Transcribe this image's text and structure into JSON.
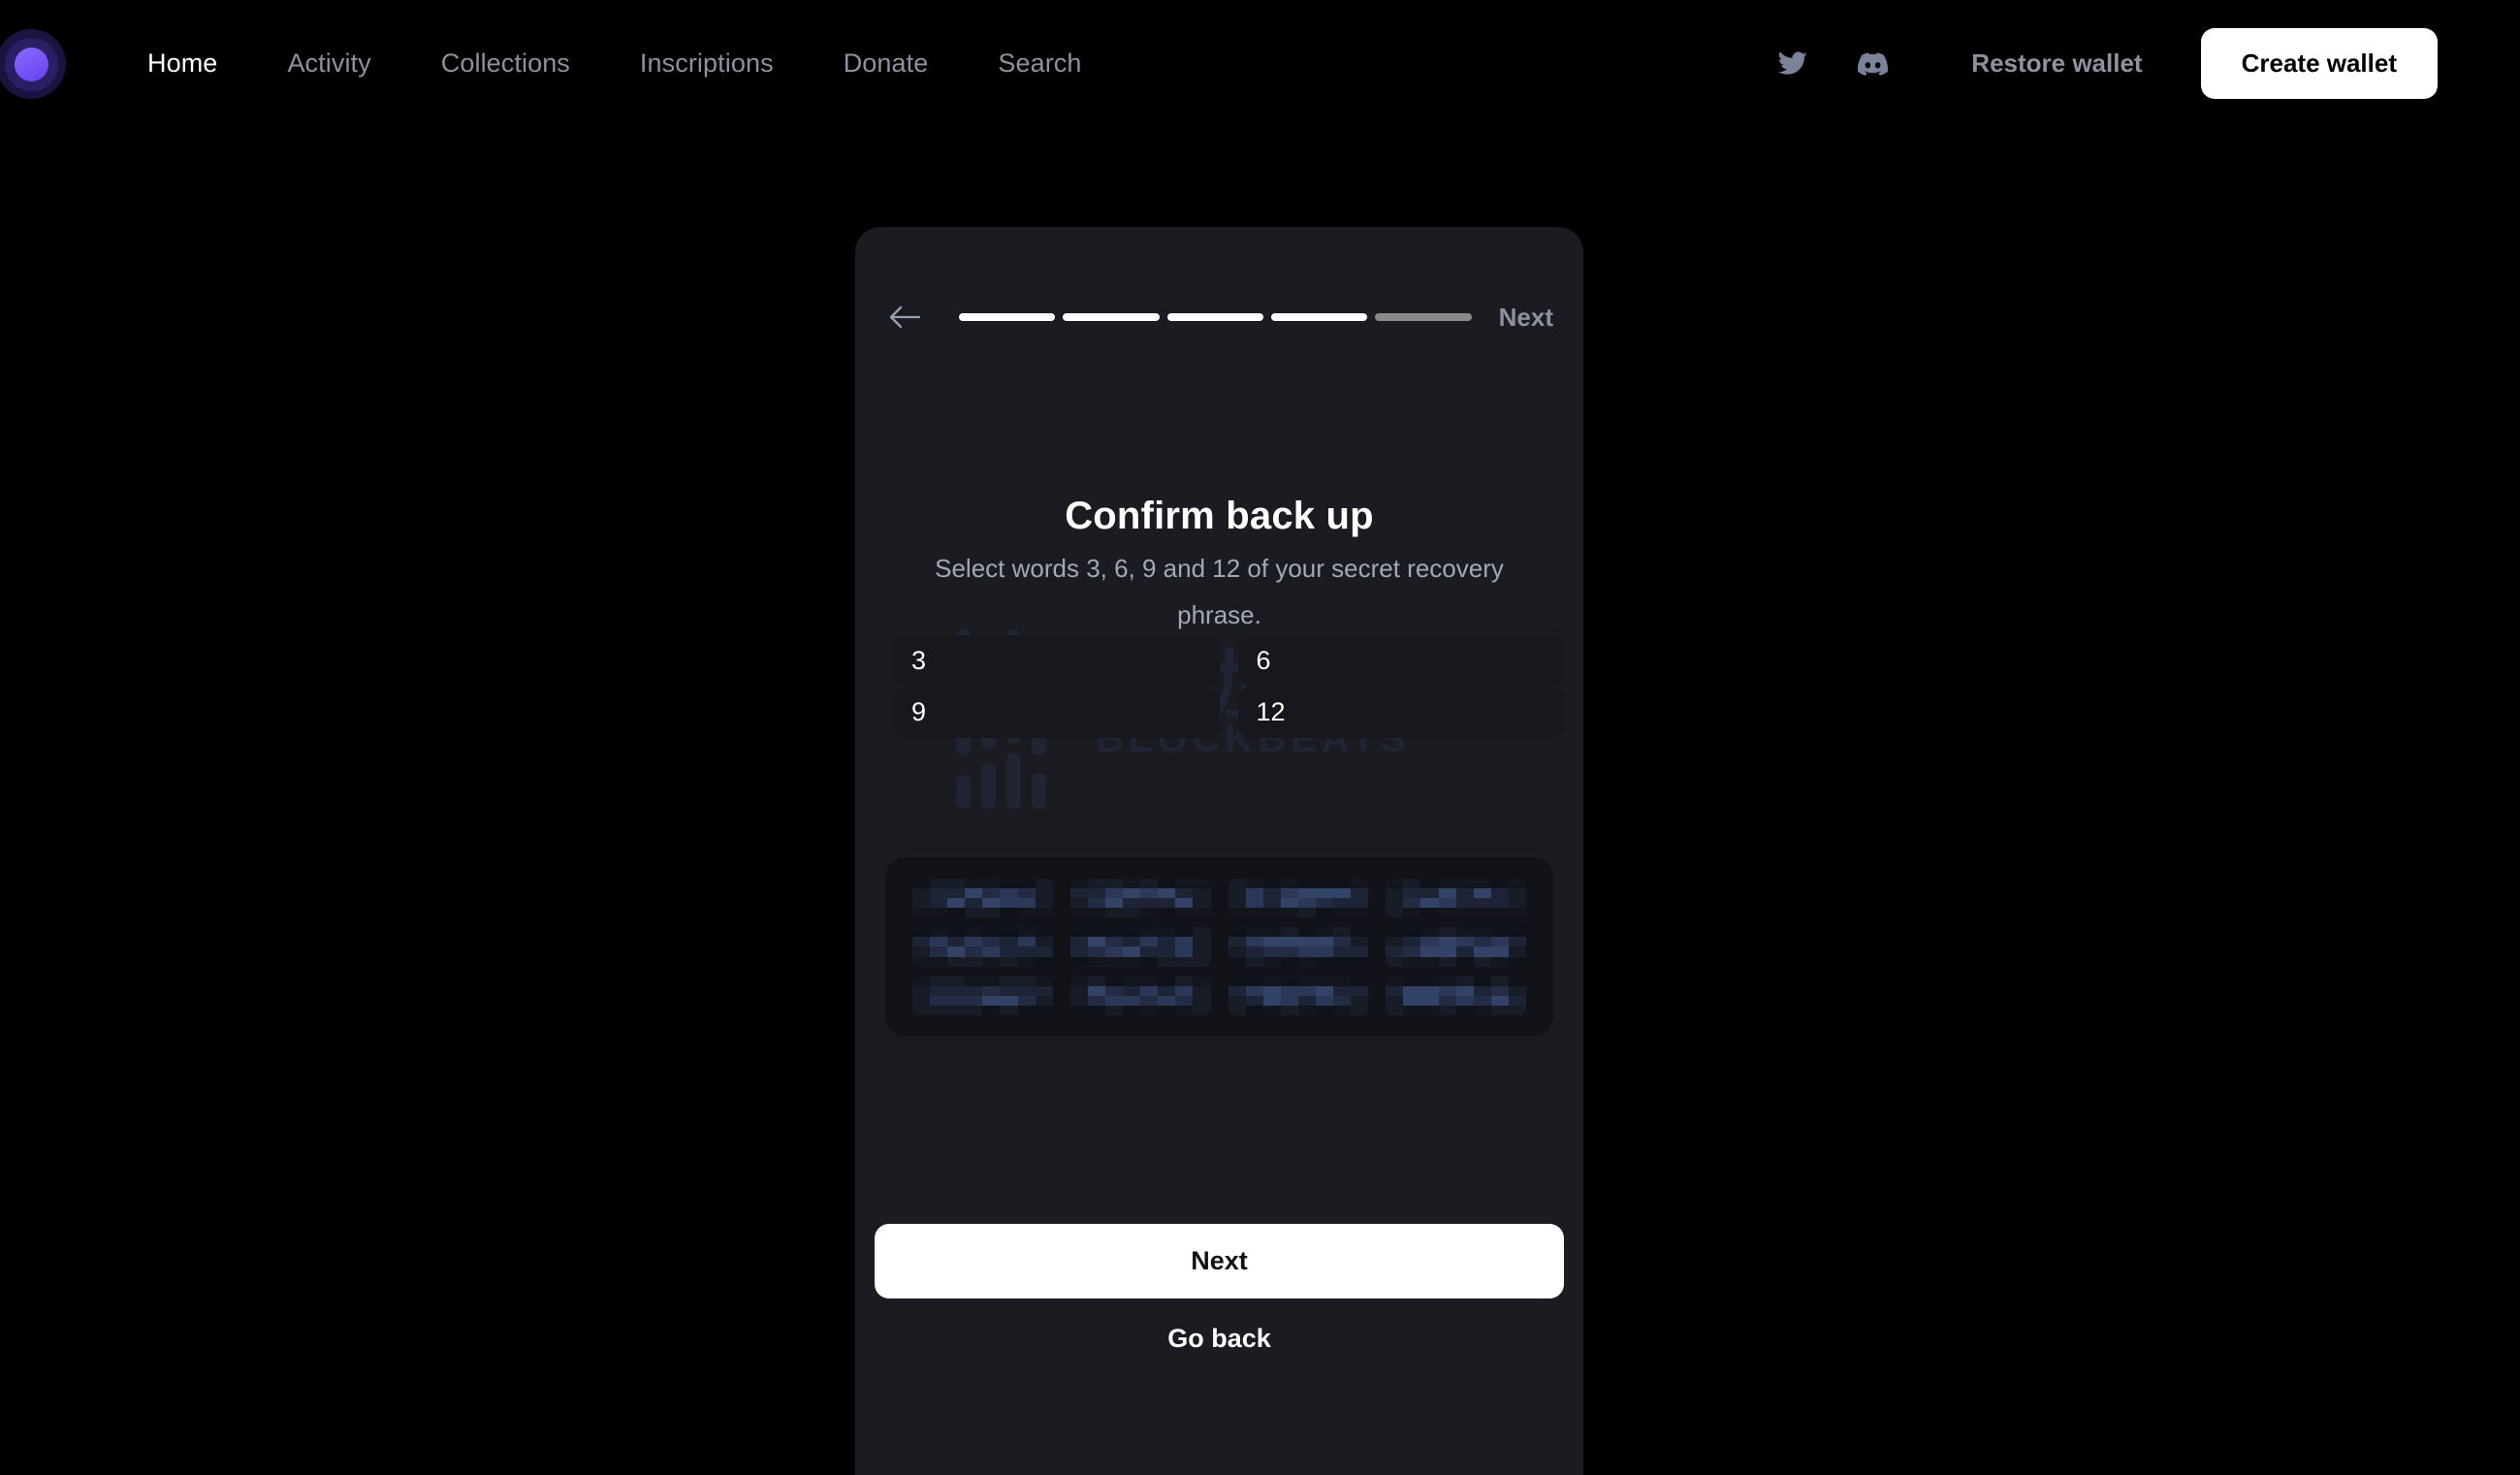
{
  "site": {
    "background_color": "#000000",
    "logo_name": "app-logo",
    "logo_color": "#6341f0"
  },
  "nav": {
    "items": [
      {
        "label": "Home",
        "active": true
      },
      {
        "label": "Activity",
        "active": false
      },
      {
        "label": "Collections",
        "active": false
      },
      {
        "label": "Inscriptions",
        "active": false
      },
      {
        "label": "Donate",
        "active": false
      },
      {
        "label": "Search",
        "active": false
      }
    ],
    "social": [
      {
        "name": "twitter-icon"
      },
      {
        "name": "discord-icon"
      }
    ],
    "restore_label": "Restore wallet",
    "create_label": "Create wallet"
  },
  "modal": {
    "background_color": "#1a1c21",
    "header": {
      "back_icon": "arrow-left-icon",
      "next_label": "Next",
      "progress": {
        "total_steps": 5,
        "completed_steps": 4,
        "done_color": "#ffffff",
        "pending_color": "#8a8a8a"
      }
    },
    "title": "Confirm back up",
    "subtitle": "Select words 3, 6, 9 and 12 of your secret recovery phrase.",
    "slots": [
      {
        "number": "3",
        "value": ""
      },
      {
        "number": "6",
        "value": ""
      },
      {
        "number": "9",
        "value": ""
      },
      {
        "number": "12",
        "value": ""
      }
    ],
    "word_pool": {
      "censored": true,
      "count": 12,
      "chips": [
        {
          "index": 1,
          "label": ""
        },
        {
          "index": 2,
          "label": ""
        },
        {
          "index": 3,
          "label": ""
        },
        {
          "index": 4,
          "label": ""
        },
        {
          "index": 5,
          "label": ""
        },
        {
          "index": 6,
          "label": ""
        },
        {
          "index": 7,
          "label": ""
        },
        {
          "index": 8,
          "label": ""
        },
        {
          "index": 9,
          "label": ""
        },
        {
          "index": 10,
          "label": ""
        },
        {
          "index": 11,
          "label": ""
        },
        {
          "index": 12,
          "label": ""
        }
      ]
    },
    "primary_button": "Next",
    "secondary_button": "Go back"
  },
  "watermark": {
    "cn_text": "律动",
    "en_text": "BLOCKBEATS",
    "color": "#2b3350"
  }
}
